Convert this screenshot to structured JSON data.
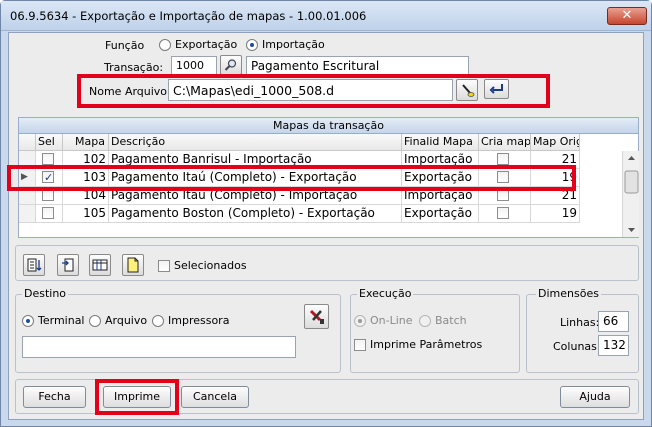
{
  "window": {
    "title": "06.9.5634 - Exportação e Importação de mapas - 1.00.01.006",
    "close_glyph": "✕"
  },
  "funcao": {
    "label": "Função",
    "options": [
      "Exportação",
      "Importação"
    ],
    "selected": "Importação"
  },
  "transacao": {
    "label": "Transação:",
    "code": "1000",
    "description": "Pagamento Escritural"
  },
  "nome_arquivo": {
    "label": "Nome Arquivo:",
    "value": "C:\\Mapas\\edi_1000_508.d"
  },
  "grid": {
    "title": "Mapas da transação",
    "columns": [
      "Sel",
      "Mapa",
      "Descrição",
      "Finalid Mapa",
      "Cria mapa",
      "Map Orig"
    ],
    "rows": [
      {
        "sel": false,
        "mapa": "102",
        "descricao": "Pagamento Banrisul - Importação",
        "finalidade": "Importação",
        "cria": false,
        "orig": "21"
      },
      {
        "sel": true,
        "mapa": "103",
        "descricao": "Pagamento Itaú (Completo) - Exportação",
        "finalidade": "Exportação",
        "cria": false,
        "orig": "19"
      },
      {
        "sel": false,
        "mapa": "104",
        "descricao": "Pagamento Itaú (Completo) - Importação",
        "finalidade": "Importação",
        "cria": false,
        "orig": "21"
      },
      {
        "sel": false,
        "mapa": "105",
        "descricao": "Pagamento Boston (Completo) - Exportação",
        "finalidade": "Exportação",
        "cria": false,
        "orig": "19"
      }
    ],
    "current_row_marker": "▶"
  },
  "toolbar": {
    "selecionados_label": "Selecionados"
  },
  "destino": {
    "title": "Destino",
    "options": [
      "Terminal",
      "Arquivo",
      "Impressora"
    ],
    "selected": "Terminal",
    "path_value": ""
  },
  "execucao": {
    "title": "Execução",
    "options": [
      "On-Line",
      "Batch"
    ],
    "selected": "On-Line",
    "imprime_parametros_label": "Imprime Parâmetros"
  },
  "dimensoes": {
    "title": "Dimensões",
    "linhas_label": "Linhas:",
    "linhas": "66",
    "colunas_label": "Colunas:",
    "colunas": "132"
  },
  "buttons": {
    "fecha": "Fecha",
    "imprime": "Imprime",
    "cancela": "Cancela",
    "ajuda": "Ajuda"
  },
  "colors": {
    "highlight": "#e3001b",
    "titlebar": "#c9d8ec",
    "grid_header": "#c5d5ea"
  }
}
